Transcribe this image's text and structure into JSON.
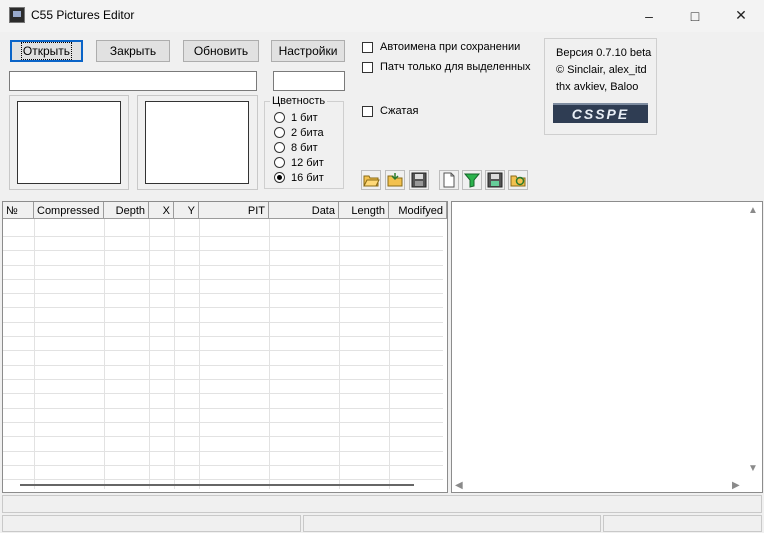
{
  "window": {
    "title": "C55 Pictures Editor",
    "controls": {
      "minimize": "–",
      "maximize": "□",
      "close": "✕"
    }
  },
  "toolbar": {
    "open_label": "Открыть",
    "close_label": "Закрыть",
    "refresh_label": "Обновить",
    "settings_label": "Настройки"
  },
  "color_depth": {
    "title": "Цветность",
    "options": [
      {
        "label": "1 бит",
        "checked": false
      },
      {
        "label": "2 бита",
        "checked": false
      },
      {
        "label": "8 бит",
        "checked": false
      },
      {
        "label": "12 бит",
        "checked": false
      },
      {
        "label": "16 бит",
        "checked": true
      }
    ]
  },
  "options": {
    "auto_rename_label": "Автоимена при сохранении",
    "patch_selected_label": "Патч только для выделенных",
    "compressed_label": "Сжатая"
  },
  "version": {
    "line1": "Версия 0.7.10 beta",
    "line2": "© Sinclair, alex_itd",
    "line3": "thx avkiev, Baloo",
    "logo": "CSSPE"
  },
  "icons": [
    "open-folder-icon",
    "import-folder-icon",
    "save-icon",
    "new-file-icon",
    "filter-icon",
    "save-as-icon",
    "refresh-save-icon"
  ],
  "table": {
    "columns": [
      "№",
      "Compressed",
      "Depth",
      "X",
      "Y",
      "PIT",
      "Data",
      "Length",
      "Modifyed"
    ]
  }
}
